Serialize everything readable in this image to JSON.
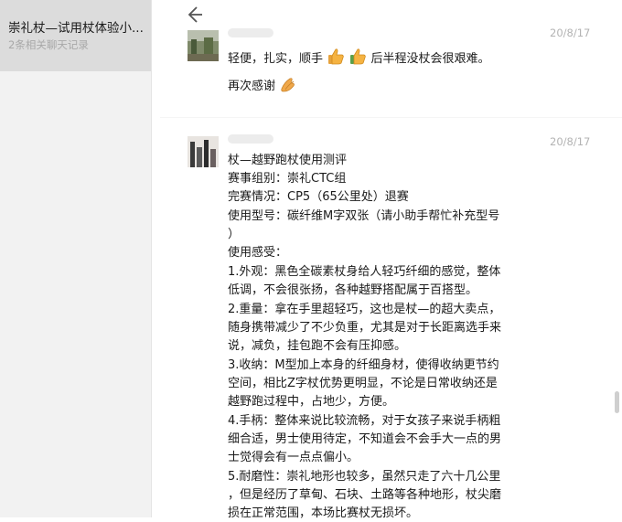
{
  "sidebar": {
    "items": [
      {
        "title": "崇礼杖—试用杖体验小...",
        "subtitle": "2条相关聊天记录"
      }
    ]
  },
  "header": {
    "back_icon": "back-arrow-icon"
  },
  "messages": [
    {
      "time": "20/8/17",
      "lines": [
        "轻便，扎实，顺手",
        "后半程没杖会很艰难。",
        "再次感谢"
      ],
      "emoji": [
        "thumbs-up-icon",
        "thumbs-up-icon",
        "clap-hands-icon"
      ]
    },
    {
      "time": "20/8/17",
      "lines": [
        "杖—越野跑杖使用测评",
        "赛事组别：崇礼CTC组",
        "完赛情况：CP5（65公里处）退赛",
        "使用型号：碳纤维M字双张（请小助手帮忙补充型号",
        "）",
        "使用感受：",
        "1.外观：黑色全碳素杖身给人轻巧纤细的感觉，整体",
        "低调，不会很张扬，各种越野搭配属于百搭型。",
        "2.重量：拿在手里超轻巧，这也是杖—的超大卖点，",
        "随身携带减少了不少负重，尤其是对于长距离选手来",
        "说，减负，挂包跑不会有压抑感。",
        "3.收纳：M型加上本身的纤细身材，使得收纳更节约",
        "空间，相比Z字杖优势更明显，不论是日常收纳还是",
        "越野跑过程中，占地少，方便。",
        "4.手柄：整体来说比较流畅，对于女孩子来说手柄粗",
        "细合适，男士使用待定，不知道会不会手大一点的男",
        "士觉得会有一点点偏小。",
        "5.耐磨性：崇礼地形也较多，虽然只走了六十几公里",
        "，但是经历了草甸、石块、土路等各种地形，杖尖磨",
        "损在正常范围，本场比赛杖无损坏。"
      ]
    }
  ]
}
